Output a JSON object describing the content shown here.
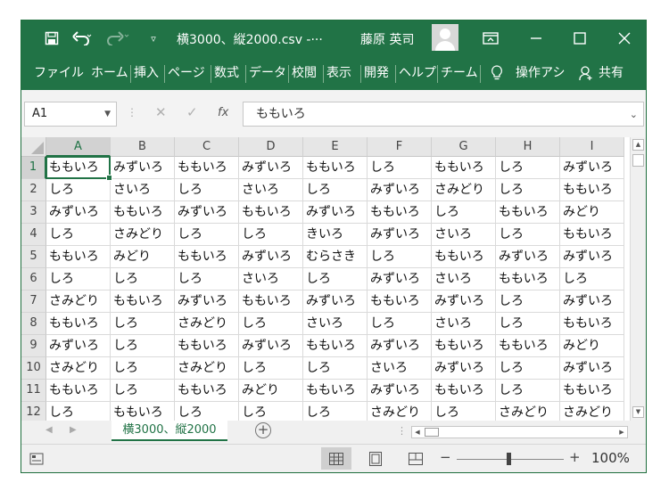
{
  "window": {
    "title": "横3000、縦2000.csv  -···",
    "user": "藤原 英司",
    "accent": "#217346"
  },
  "ribbon": {
    "tabs": [
      "ファイル",
      "ホーム",
      "挿入",
      "ページ",
      "数式",
      "データ",
      "校閲",
      "表示",
      "開発",
      "ヘルプ",
      "チーム",
      "操作アシ",
      "共有"
    ]
  },
  "formula_bar": {
    "name_box": "A1",
    "fx": "fx",
    "value": "ももいろ"
  },
  "grid": {
    "columns": [
      "A",
      "B",
      "C",
      "D",
      "E",
      "F",
      "G",
      "H",
      "I"
    ],
    "rows": [
      "1",
      "2",
      "3",
      "4",
      "5",
      "6",
      "7",
      "8",
      "9",
      "10",
      "11",
      "12"
    ],
    "cells": [
      [
        "ももいろ",
        "みずいろ",
        "ももいろ",
        "みずいろ",
        "ももいろ",
        "しろ",
        "ももいろ",
        "しろ",
        "みずいろ"
      ],
      [
        "しろ",
        "さいろ",
        "しろ",
        "さいろ",
        "しろ",
        "みずいろ",
        "さみどり",
        "しろ",
        "ももいろ"
      ],
      [
        "みずいろ",
        "ももいろ",
        "みずいろ",
        "ももいろ",
        "みずいろ",
        "ももいろ",
        "しろ",
        "ももいろ",
        "みどり"
      ],
      [
        "しろ",
        "さみどり",
        "しろ",
        "しろ",
        "きいろ",
        "みずいろ",
        "さいろ",
        "しろ",
        "ももいろ"
      ],
      [
        "ももいろ",
        "みどり",
        "ももいろ",
        "みずいろ",
        "むらさき",
        "しろ",
        "ももいろ",
        "みずいろ",
        "みずいろ"
      ],
      [
        "しろ",
        "しろ",
        "しろ",
        "さいろ",
        "しろ",
        "みずいろ",
        "さいろ",
        "ももいろ",
        "しろ"
      ],
      [
        "さみどり",
        "ももいろ",
        "みずいろ",
        "ももいろ",
        "みずいろ",
        "ももいろ",
        "みずいろ",
        "しろ",
        "みずいろ"
      ],
      [
        "ももいろ",
        "しろ",
        "さみどり",
        "しろ",
        "さいろ",
        "しろ",
        "さいろ",
        "しろ",
        "ももいろ"
      ],
      [
        "みずいろ",
        "しろ",
        "ももいろ",
        "みずいろ",
        "ももいろ",
        "みずいろ",
        "ももいろ",
        "ももいろ",
        "みどり"
      ],
      [
        "さみどり",
        "しろ",
        "さみどり",
        "しろ",
        "しろ",
        "さいろ",
        "みずいろ",
        "しろ",
        "みずいろ"
      ],
      [
        "ももいろ",
        "しろ",
        "ももいろ",
        "みどり",
        "ももいろ",
        "みずいろ",
        "ももいろ",
        "しろ",
        "ももいろ"
      ],
      [
        "しろ",
        "ももいろ",
        "しろ",
        "しろ",
        "しろ",
        "さみどり",
        "しろ",
        "さみどり",
        "さみどり"
      ]
    ],
    "active_cell": "A1"
  },
  "sheets": {
    "tabs": [
      "横3000、縦2000"
    ],
    "active": "横3000、縦2000"
  },
  "status": {
    "zoom": "100%",
    "zoom_minus": "−",
    "zoom_plus": "+"
  }
}
